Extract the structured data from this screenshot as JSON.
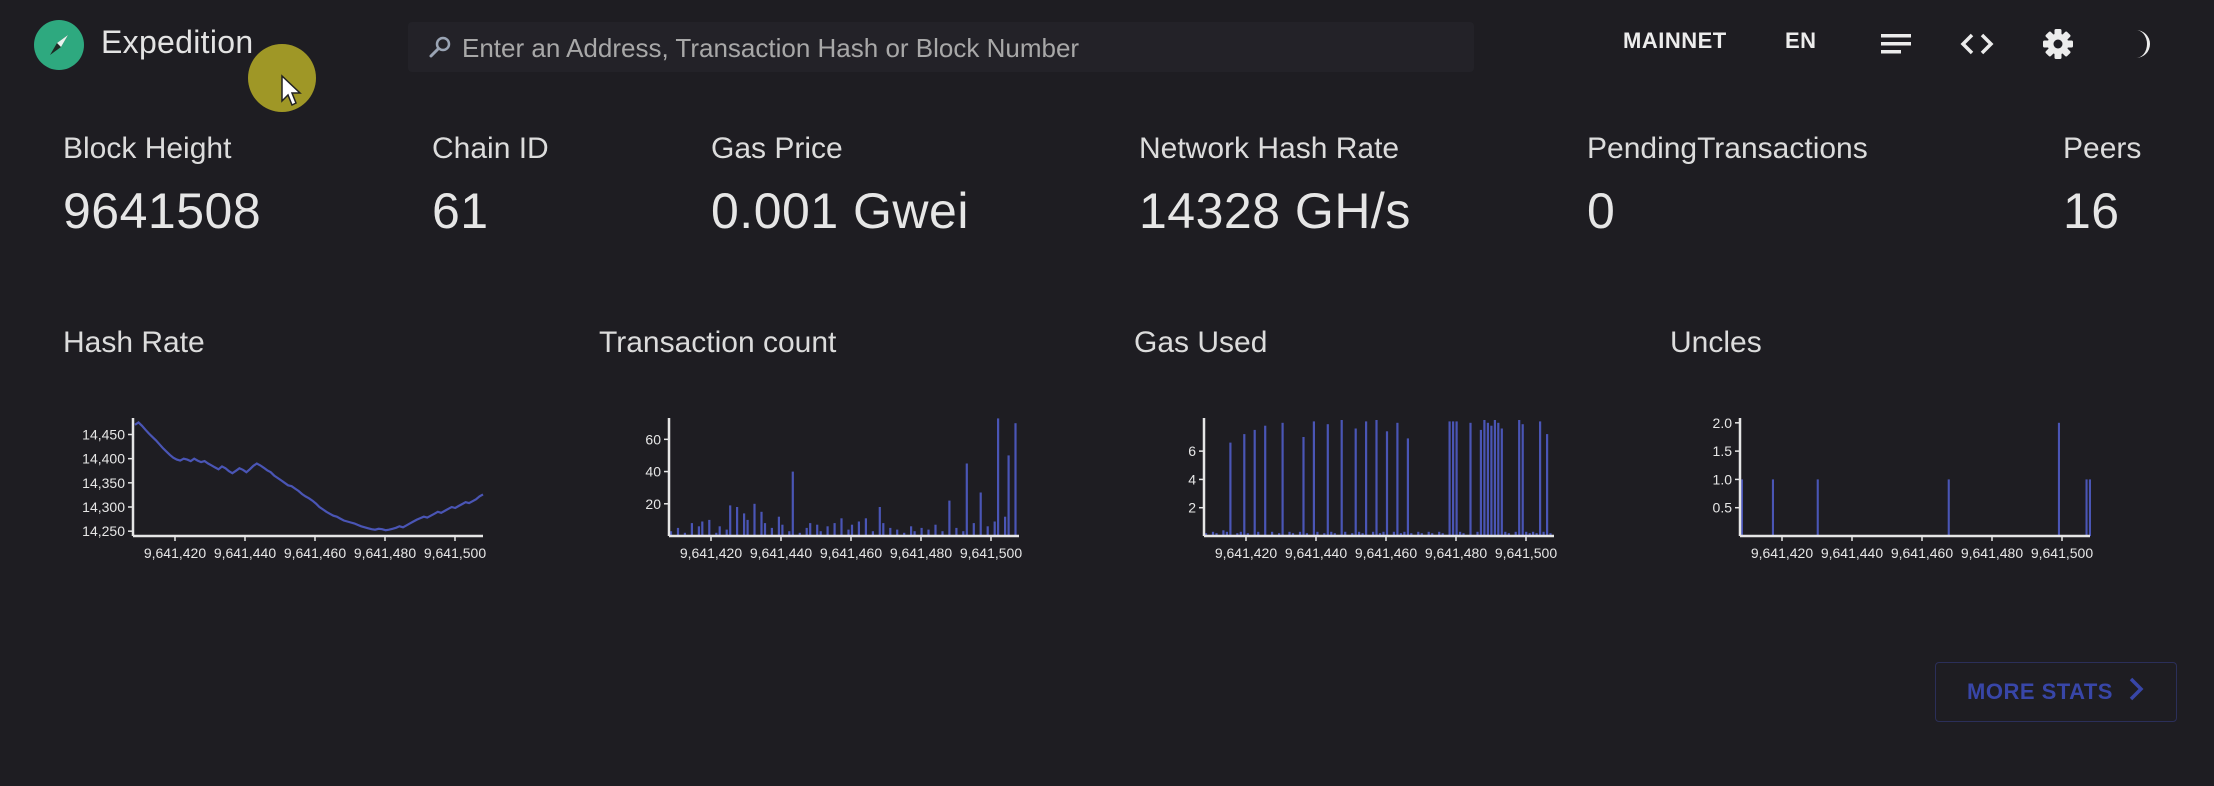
{
  "header": {
    "brand": "Expedition",
    "search_placeholder": "Enter an Address, Transaction Hash or Block Number",
    "search_value": "",
    "network": "MAINNET",
    "language": "EN",
    "icons": [
      "compass-logo-icon",
      "search-icon",
      "menu-icon",
      "code-icon",
      "gear-icon",
      "moon-icon"
    ]
  },
  "stats": [
    {
      "label": "Block Height",
      "value": "9641508"
    },
    {
      "label": "Chain ID",
      "value": "61"
    },
    {
      "label": "Gas Price",
      "value": "0.001 Gwei"
    },
    {
      "label": "Network Hash Rate",
      "value": "14328 GH/s"
    },
    {
      "label": "PendingTransactions",
      "value": "0"
    },
    {
      "label": "Peers",
      "value": "16"
    }
  ],
  "more_stats_label": "MORE STATS",
  "colors": {
    "series": "#4a55b5",
    "axis": "#e6e6e6",
    "background": "#1e1d22",
    "accent": "#2ea97f"
  },
  "chart_data": [
    {
      "type": "line",
      "title": "Hash Rate",
      "xlim": [
        9641408,
        9641508
      ],
      "ylim": [
        14240,
        14480
      ],
      "x_ticks": [
        "9,641,420",
        "9,641,440",
        "9,641,460",
        "9,641,480",
        "9,641,500"
      ],
      "y_ticks": [
        "14,450",
        "14,400",
        "14,350",
        "14,300",
        "14,250"
      ],
      "y_tick_values": [
        14450,
        14400,
        14350,
        14300,
        14250
      ],
      "values": [
        14470,
        14475,
        14468,
        14460,
        14452,
        14445,
        14438,
        14430,
        14422,
        14415,
        14408,
        14402,
        14398,
        14396,
        14400,
        14398,
        14395,
        14400,
        14396,
        14393,
        14395,
        14390,
        14386,
        14382,
        14378,
        14384,
        14380,
        14374,
        14370,
        14375,
        14380,
        14377,
        14372,
        14378,
        14385,
        14390,
        14386,
        14381,
        14376,
        14372,
        14365,
        14360,
        14355,
        14350,
        14345,
        14343,
        14338,
        14333,
        14327,
        14322,
        14318,
        14313,
        14307,
        14300,
        14295,
        14290,
        14286,
        14282,
        14280,
        14276,
        14272,
        14270,
        14268,
        14266,
        14263,
        14260,
        14258,
        14256,
        14254,
        14253,
        14255,
        14254,
        14252,
        14253,
        14255,
        14257,
        14260,
        14258,
        14262,
        14266,
        14270,
        14274,
        14277,
        14280,
        14278,
        14282,
        14286,
        14290,
        14288,
        14292,
        14296,
        14300,
        14298,
        14302,
        14306,
        14310,
        14308,
        14312,
        14316,
        14322,
        14326
      ]
    },
    {
      "type": "bar",
      "title": "Transaction count",
      "xlim": [
        9641408,
        9641508
      ],
      "ylim": [
        0,
        72
      ],
      "x_ticks": [
        "9,641,420",
        "9,641,440",
        "9,641,460",
        "9,641,480",
        "9,641,500"
      ],
      "y_ticks": [
        "60",
        "40",
        "20"
      ],
      "y_tick_values": [
        60,
        40,
        20
      ],
      "values": [
        3,
        0,
        5,
        0,
        2,
        0,
        8,
        0,
        6,
        9,
        0,
        10,
        0,
        2,
        6,
        0,
        4,
        19,
        0,
        18,
        0,
        14,
        10,
        0,
        20,
        0,
        15,
        8,
        0,
        5,
        0,
        12,
        7,
        0,
        3,
        40,
        0,
        2,
        0,
        5,
        8,
        0,
        7,
        3,
        0,
        6,
        0,
        8,
        0,
        11,
        0,
        4,
        7,
        0,
        9,
        0,
        11,
        0,
        3,
        0,
        18,
        8,
        0,
        5,
        0,
        4,
        0,
        2,
        0,
        6,
        3,
        0,
        5,
        0,
        4,
        0,
        7,
        0,
        3,
        0,
        22,
        0,
        5,
        0,
        3,
        45,
        0,
        8,
        0,
        27,
        0,
        6,
        0,
        9,
        73,
        0,
        12,
        50,
        0,
        70,
        0
      ]
    },
    {
      "type": "bar",
      "title": "Gas Used",
      "xlim": [
        9641408,
        9641508
      ],
      "ylim": [
        0,
        8.2
      ],
      "x_ticks": [
        "9,641,420",
        "9,641,440",
        "9,641,460",
        "9,641,480",
        "9,641,500"
      ],
      "y_ticks": [
        "6",
        "4",
        "2"
      ],
      "y_tick_values": [
        6,
        4,
        2
      ],
      "values": [
        0.2,
        0,
        0.3,
        0.2,
        0,
        0.4,
        0.3,
        6.6,
        0,
        0.2,
        0.3,
        7.2,
        0.2,
        0,
        7.5,
        0.3,
        0,
        7.8,
        0,
        0.3,
        0,
        0.2,
        8,
        0,
        0.3,
        0.2,
        0,
        0.3,
        7,
        0.2,
        0,
        8.1,
        0.3,
        0,
        0.2,
        7.9,
        0.3,
        0.2,
        0,
        8.2,
        0.3,
        0,
        0.2,
        7.6,
        0.3,
        0.2,
        8.1,
        0,
        0.3,
        8.2,
        0.2,
        0.3,
        7.4,
        0,
        0.3,
        8,
        0.2,
        0.3,
        6.9,
        0.2,
        0,
        0.3,
        0.2,
        0,
        0.3,
        0.2,
        0,
        0.3,
        0.2,
        0,
        8.1,
        8.1,
        8.1,
        0.3,
        0.2,
        0,
        8,
        0,
        0.3,
        7.5,
        8.2,
        8,
        7.8,
        8.2,
        8,
        7.6,
        0.3,
        0.2,
        0,
        0.3,
        8.2,
        7.9,
        0.3,
        0.2,
        0.3,
        0.2,
        8.1,
        0.3,
        7.2,
        0.2,
        0
      ]
    },
    {
      "type": "bar",
      "title": "Uncles",
      "xlim": [
        9641408,
        9641508
      ],
      "ylim": [
        0,
        2.05
      ],
      "x_ticks": [
        "9,641,420",
        "9,641,440",
        "9,641,460",
        "9,641,480",
        "9,641,500"
      ],
      "y_ticks": [
        "2.0",
        "1.5",
        "1.0",
        "0.5"
      ],
      "y_tick_values": [
        2.0,
        1.5,
        1.0,
        0.5
      ],
      "values": [
        1,
        0,
        0,
        0,
        0,
        0,
        0,
        0,
        0,
        1,
        0,
        0,
        0,
        0,
        0,
        0,
        0,
        0,
        0,
        0,
        0,
        0,
        1,
        0,
        0,
        0,
        0,
        0,
        0,
        0,
        0,
        0,
        0,
        0,
        0,
        0,
        0,
        0,
        0,
        0,
        0,
        0,
        0,
        0,
        0,
        0,
        0,
        0,
        0,
        0,
        0,
        0,
        0,
        0,
        0,
        0,
        0,
        0,
        0,
        0,
        1,
        0,
        0,
        0,
        0,
        0,
        0,
        0,
        0,
        0,
        0,
        0,
        0,
        0,
        0,
        0,
        0,
        0,
        0,
        0,
        0,
        0,
        0,
        0,
        0,
        0,
        0,
        0,
        0,
        0,
        0,
        0,
        2,
        0,
        0,
        0,
        0,
        0,
        0,
        0,
        1,
        1
      ]
    }
  ]
}
